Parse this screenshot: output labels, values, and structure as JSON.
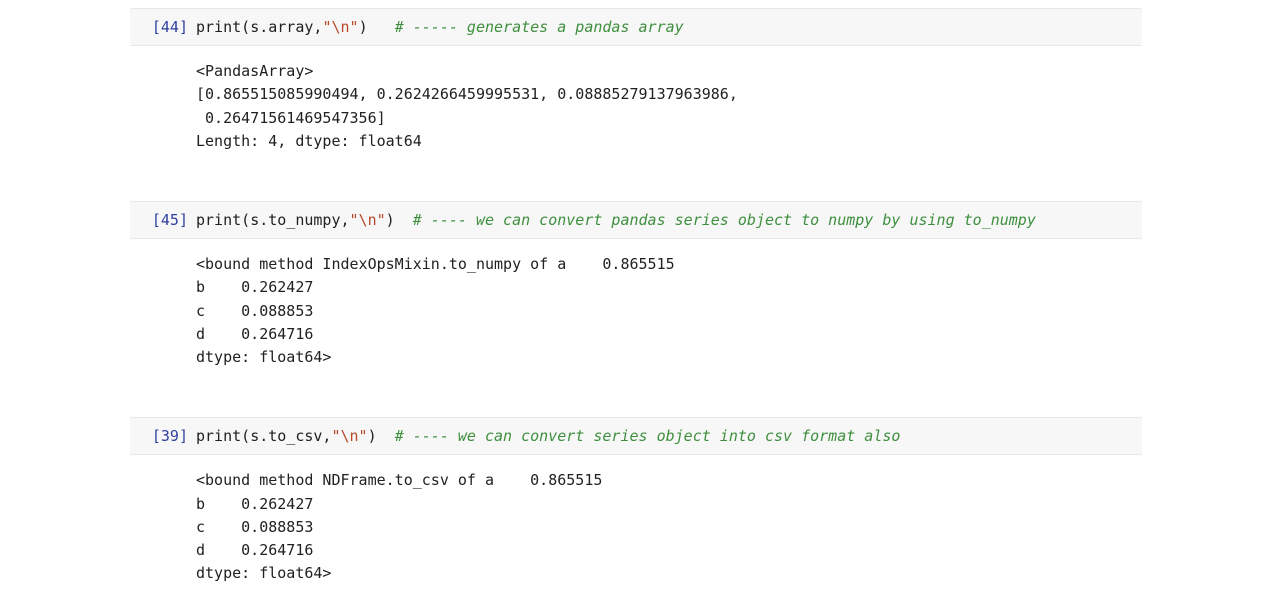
{
  "cells": [
    {
      "prompt": "[44]",
      "code": {
        "fn": "print",
        "open": "(",
        "arg1": "s.array,",
        "str": "\"\\n\"",
        "close": ")",
        "pad": "   ",
        "comment": "# ----- generates a pandas array"
      },
      "output": "<PandasArray>\n[0.865515085990494, 0.2624266459995531, 0.08885279137963986,\n 0.26471561469547356]\nLength: 4, dtype: float64"
    },
    {
      "prompt": "[45]",
      "code": {
        "fn": "print",
        "open": "(",
        "arg1": "s.to_numpy,",
        "str": "\"\\n\"",
        "close": ")",
        "pad": "  ",
        "comment": "# ---- we can convert pandas series object to numpy by using to_numpy"
      },
      "output": "<bound method IndexOpsMixin.to_numpy of a    0.865515\nb    0.262427\nc    0.088853\nd    0.264716\ndtype: float64>"
    },
    {
      "prompt": "[39]",
      "code": {
        "fn": "print",
        "open": "(",
        "arg1": "s.to_csv,",
        "str": "\"\\n\"",
        "close": ")",
        "pad": "  ",
        "comment": "# ---- we can convert series object into csv format also"
      },
      "output": "<bound method NDFrame.to_csv of a    0.865515\nb    0.262427\nc    0.088853\nd    0.264716\ndtype: float64>"
    }
  ]
}
